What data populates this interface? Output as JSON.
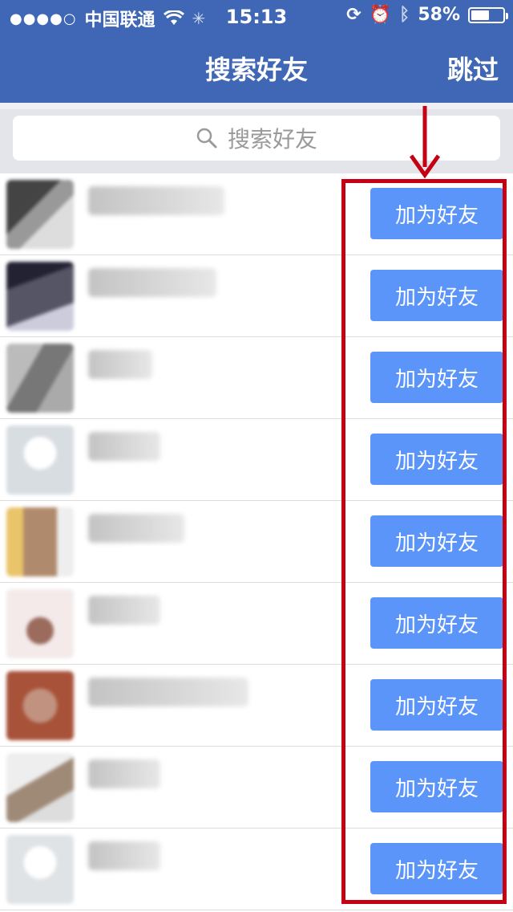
{
  "status_bar": {
    "carrier": "中国联通",
    "time": "15:13",
    "battery_text": "58%",
    "battery_level": 0.58
  },
  "nav": {
    "title": "搜索好友",
    "skip_label": "跳过"
  },
  "search": {
    "placeholder": "搜索好友"
  },
  "contacts": [
    {
      "name": "",
      "add_label": "加为好友"
    },
    {
      "name": "",
      "add_label": "加为好友"
    },
    {
      "name": "",
      "add_label": "加为好友"
    },
    {
      "name": "",
      "add_label": "加为好友"
    },
    {
      "name": "",
      "add_label": "加为好友"
    },
    {
      "name": "",
      "add_label": "加为好友"
    },
    {
      "name": "",
      "add_label": "加为好友"
    },
    {
      "name": "",
      "add_label": "加为好友"
    },
    {
      "name": "",
      "add_label": "加为好友"
    }
  ],
  "colors": {
    "nav_bg": "#3f67b6",
    "button_bg": "#5b95f9",
    "annotation_red": "#c40012"
  }
}
